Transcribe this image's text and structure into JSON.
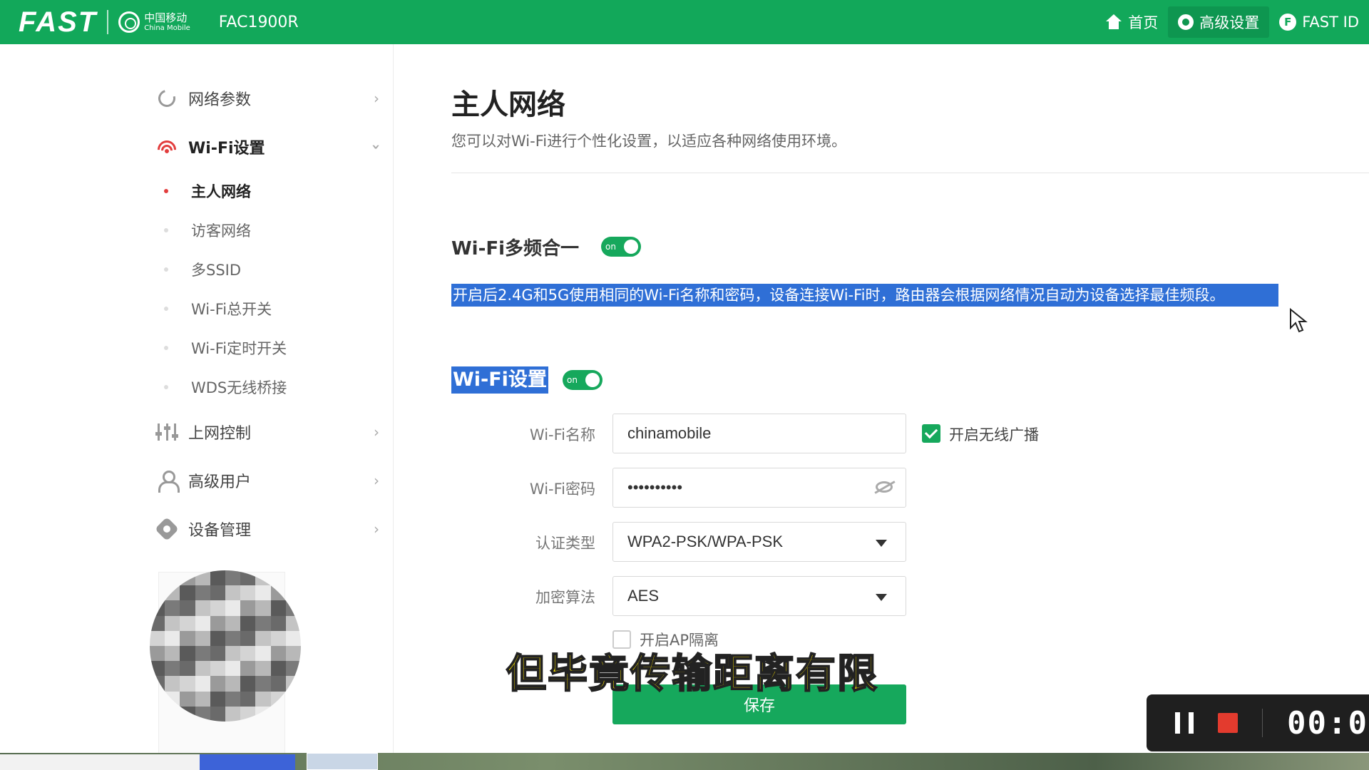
{
  "header": {
    "brand": "FAST",
    "partner_zh": "中国移动",
    "partner_en": "China Mobile",
    "model": "FAC1900R",
    "nav": [
      {
        "label": "首页",
        "icon": "home-icon"
      },
      {
        "label": "高级设置",
        "icon": "gear-icon"
      },
      {
        "label": "FAST ID",
        "icon": "fast-id-icon"
      }
    ]
  },
  "sidebar": {
    "items": [
      {
        "label": "网络参数",
        "icon": "network-icon"
      },
      {
        "label": "Wi-Fi设置",
        "icon": "wifi-icon"
      },
      {
        "label": "上网控制",
        "icon": "sliders-icon"
      },
      {
        "label": "高级用户",
        "icon": "user-icon"
      },
      {
        "label": "设备管理",
        "icon": "device-icon"
      }
    ],
    "wifi_sub": [
      {
        "label": "主人网络",
        "active": true
      },
      {
        "label": "访客网络",
        "active": false
      },
      {
        "label": "多SSID",
        "active": false
      },
      {
        "label": "Wi-Fi总开关",
        "active": false
      },
      {
        "label": "Wi-Fi定时开关",
        "active": false
      },
      {
        "label": "WDS无线桥接",
        "active": false
      }
    ]
  },
  "main": {
    "title": "主人网络",
    "description": "您可以对Wi-Fi进行个性化设置，以适应各种网络使用环境。",
    "multiband": {
      "title": "Wi-Fi多频合一",
      "toggle": "on",
      "description": "开启后2.4G和5G使用相同的Wi-Fi名称和密码，设备连接Wi-Fi时，路由器会根据网络情况自动为设备选择最佳频段。"
    },
    "wifi_settings": {
      "title": "Wi-Fi设置",
      "toggle": "on",
      "name_label": "Wi-Fi名称",
      "name_value": "chinamobile",
      "broadcast_label": "开启无线广播",
      "broadcast_checked": true,
      "password_label": "Wi-Fi密码",
      "password_value": "••••••••••",
      "auth_label": "认证类型",
      "auth_value": "WPA2-PSK/WPA-PSK",
      "encrypt_label": "加密算法",
      "encrypt_value": "AES",
      "ap_isolation_label": "开启AP隔离",
      "ap_isolation_checked": false,
      "save_label": "保存"
    }
  },
  "subtitle": "但毕竟传输距离有限",
  "recorder": {
    "time": "00:0"
  },
  "colors": {
    "brand_green": "#12a85a",
    "toggle_green": "#16a85c",
    "selection_blue": "#2f6fd6",
    "active_dot_red": "#e23d3d",
    "subtitle_yellow": "#ffe600",
    "recorder_stop_red": "#e33b2e"
  }
}
